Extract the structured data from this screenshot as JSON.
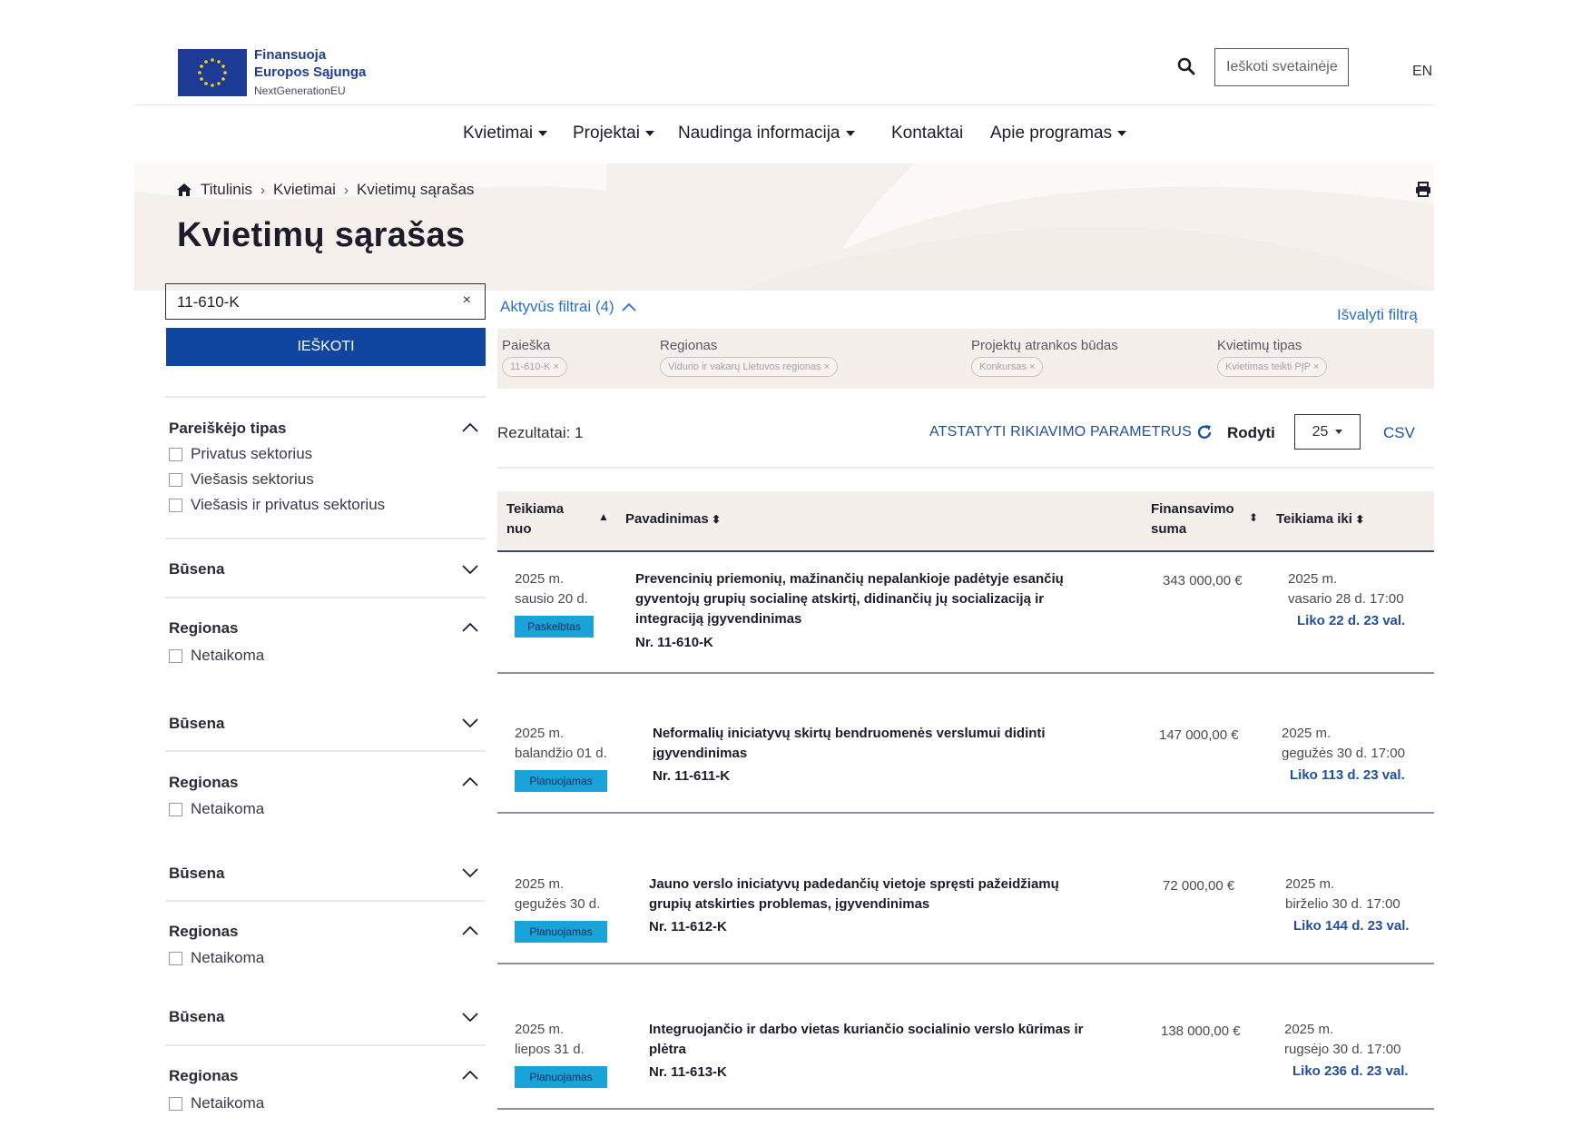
{
  "header": {
    "logo_line1": "Finansuoja",
    "logo_line2": "Europos Sąjunga",
    "logo_line3": "NextGenerationEU",
    "search_placeholder": "Ieškoti svetainėje",
    "lang": "EN"
  },
  "nav": {
    "items": [
      {
        "label": "Kvietimai",
        "dropdown": true
      },
      {
        "label": "Projektai",
        "dropdown": true
      },
      {
        "label": "Naudinga informacija",
        "dropdown": true
      },
      {
        "label": "Kontaktai",
        "dropdown": false
      },
      {
        "label": "Apie programas",
        "dropdown": true
      }
    ]
  },
  "breadcrumb": [
    "Titulinis",
    "Kvietimai",
    "Kvietimų sąrašas"
  ],
  "page_title": "Kvietimų sąrašas",
  "sidebar": {
    "query_value": "11-610-K",
    "clear_symbol": "×",
    "search_button": "IEŠKOTI",
    "facets": [
      {
        "title": "Pareiškėjo tipas",
        "expanded": true,
        "options": [
          "Privatus sektorius",
          "Viešasis sektorius",
          "Viešasis ir privatus sektorius"
        ]
      },
      {
        "title": "Būsena",
        "expanded": false,
        "options": []
      },
      {
        "title": "Regionas",
        "expanded": true,
        "options": [
          "Netaikoma"
        ]
      },
      {
        "title": "Būsena",
        "expanded": false,
        "options": []
      },
      {
        "title": "Regionas",
        "expanded": true,
        "options": [
          "Netaikoma"
        ]
      },
      {
        "title": "Būsena",
        "expanded": false,
        "options": []
      },
      {
        "title": "Regionas",
        "expanded": true,
        "options": [
          "Netaikoma"
        ]
      },
      {
        "title": "Būsena",
        "expanded": false,
        "options": []
      },
      {
        "title": "Regionas",
        "expanded": true,
        "options": [
          "Netaikoma"
        ]
      }
    ]
  },
  "filters": {
    "title": "Aktyvūs filtrai (4)",
    "clear_label": "Išvalyti filtrą",
    "groups": [
      {
        "label": "Paieška",
        "chip": "11-610-K ×"
      },
      {
        "label": "Regionas",
        "chip": "Vidurio ir vakarų Lietuvos regionas ×"
      },
      {
        "label": "Projektų atrankos būdas",
        "chip": "Konkursas ×"
      },
      {
        "label": "Kvietimų tipas",
        "chip": "Kvietimas teikti PĮP ×"
      }
    ]
  },
  "results": {
    "count_label": "Rezultatai: 1",
    "reset_sort": "ATSTATYTI RIKIAVIMO PARAMETRUS",
    "show_label": "Rodyti",
    "page_size": "25",
    "csv": "CSV"
  },
  "table": {
    "col_from_1": "Teikiama",
    "col_from_2": "nuo",
    "col_name": "Pavadinimas",
    "col_amount_1": "Finansavimo",
    "col_amount_2": "suma",
    "col_until": "Teikiama iki",
    "rows": [
      {
        "from_1": "2025 m.",
        "from_2": "sausio 20 d.",
        "status": "Paskelbtas",
        "title_1": "Prevencinių priemonių, mažinančių nepalankioje padėtyje esančių",
        "title_2": "gyventojų grupių socialinę atskirtį, didinančių jų socializaciją ir",
        "title_3": "integraciją įgyvendinimas",
        "number": "Nr. 11-610-K",
        "amount": "343 000,00 €",
        "until_1": "2025 m.",
        "until_2": "vasario 28 d. 17:00",
        "remaining": "Liko 22 d. 23 val."
      },
      {
        "from_1": "2025 m.",
        "from_2": "balandžio 01 d.",
        "status": "Planuojamas",
        "title_1": "Neformalių iniciatyvų skirtų bendruomenės verslumui didinti",
        "title_2": "įgyvendinimas",
        "number": "Nr. 11-611-K",
        "amount": "147 000,00 €",
        "until_1": "2025 m.",
        "until_2": "gegužės 30 d. 17:00",
        "remaining": "Liko 113 d. 23 val."
      },
      {
        "from_1": "2025 m.",
        "from_2": "gegužės 30 d.",
        "status": "Planuojamas",
        "title_1": "Jauno verslo iniciatyvų padedančių vietoje spręsti pažeidžiamų",
        "title_2": "grupių atskirties problemas, įgyvendinimas",
        "number": "Nr. 11-612-K",
        "amount": "72 000,00 €",
        "until_1": "2025 m.",
        "until_2": "birželio 30 d. 17:00",
        "remaining": "Liko 144 d. 23 val."
      },
      {
        "from_1": "2025 m.",
        "from_2": "liepos 31 d.",
        "status": "Planuojamas",
        "title_1": "Integruojančio ir darbo vietas kuriančio socialinio verslo kūrimas ir",
        "title_2": "plėtra",
        "number": "Nr. 11-613-K",
        "amount": "138 000,00 €",
        "until_1": "2025 m.",
        "until_2": "rugsėjo 30 d. 17:00",
        "remaining": "Liko 236 d. 23 val."
      }
    ]
  },
  "colors": {
    "primary": "#1146a0",
    "link": "#2a6fd6",
    "badge": "#19a3d8",
    "hero": "#f3ede7"
  }
}
